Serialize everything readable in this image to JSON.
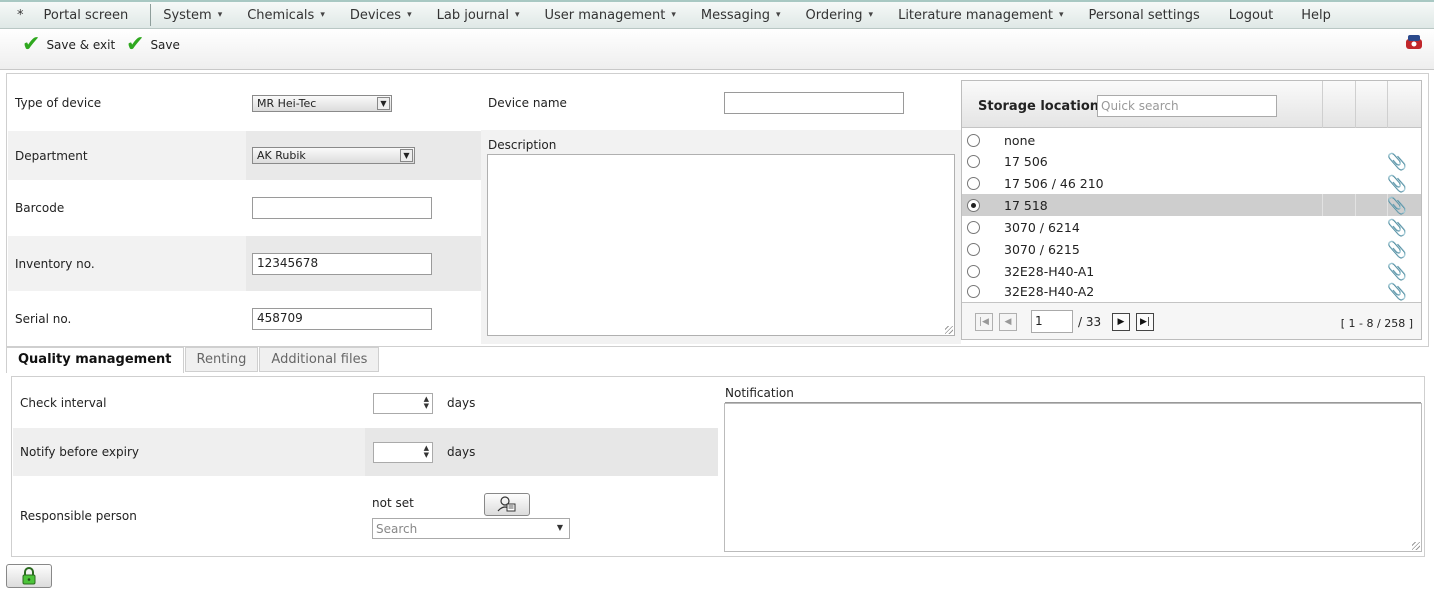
{
  "menu": {
    "home": "*",
    "items": [
      {
        "label": "Portal screen",
        "dropdown": false
      },
      {
        "label": "System",
        "dropdown": true
      },
      {
        "label": "Chemicals",
        "dropdown": true
      },
      {
        "label": "Devices",
        "dropdown": true
      },
      {
        "label": "Lab journal",
        "dropdown": true
      },
      {
        "label": "User management",
        "dropdown": true
      },
      {
        "label": "Messaging",
        "dropdown": true
      },
      {
        "label": "Ordering",
        "dropdown": true
      },
      {
        "label": "Literature management",
        "dropdown": true
      },
      {
        "label": "Personal settings",
        "dropdown": false
      },
      {
        "label": "Logout",
        "dropdown": false
      },
      {
        "label": "Help",
        "dropdown": false
      }
    ],
    "caret_glyph": "▾"
  },
  "toolbar": {
    "save_exit_label": "Save & exit",
    "save_label": "Save",
    "check_glyph": "✔",
    "exit_icon": "logout-icon"
  },
  "form": {
    "type_of_device_label": "Type of device",
    "type_of_device_value": "MR Hei-Tec",
    "department_label": "Department",
    "department_value": "AK Rubik",
    "barcode_label": "Barcode",
    "barcode_value": "",
    "inventory_label": "Inventory no.",
    "inventory_value": "12345678",
    "serial_label": "Serial no.",
    "serial_value": "458709",
    "device_name_label": "Device name",
    "device_name_value": "",
    "description_label": "Description",
    "description_value": ""
  },
  "storage": {
    "title": "Storage location",
    "search_placeholder": "Quick search",
    "rows": [
      {
        "label": "none",
        "selected": false,
        "clip": false
      },
      {
        "label": "17 506",
        "selected": false,
        "clip": true
      },
      {
        "label": "17 506 / 46 210",
        "selected": false,
        "clip": true
      },
      {
        "label": "17 518",
        "selected": true,
        "clip": true
      },
      {
        "label": "3070 / 6214",
        "selected": false,
        "clip": true
      },
      {
        "label": "3070 / 6215",
        "selected": false,
        "clip": true
      },
      {
        "label": "32E28-H40-A1",
        "selected": false,
        "clip": true
      },
      {
        "label": "32E28-H40-A2",
        "selected": false,
        "clip": true
      }
    ],
    "clip_icon": "paperclip-icon",
    "pager": {
      "page": "1",
      "total": "/ 33",
      "range": "[ 1 - 8 / 258 ]"
    }
  },
  "tabs": [
    {
      "label": "Quality management",
      "active": true
    },
    {
      "label": "Renting",
      "active": false
    },
    {
      "label": "Additional files",
      "active": false
    }
  ],
  "quality": {
    "check_interval_label": "Check interval",
    "check_interval_value": "",
    "notify_label": "Notify before expiry",
    "notify_value": "",
    "days_label": "days",
    "responsible_label": "Responsible person",
    "responsible_value": "not set",
    "search_placeholder": "Search",
    "notification_label": "Notification",
    "notification_value": ""
  },
  "footer": {
    "lock_icon": "lock-icon"
  },
  "colors": {
    "menu_accent": "#a8c8c3",
    "check_green": "#2fa81f",
    "selected_row": "#cecece"
  }
}
